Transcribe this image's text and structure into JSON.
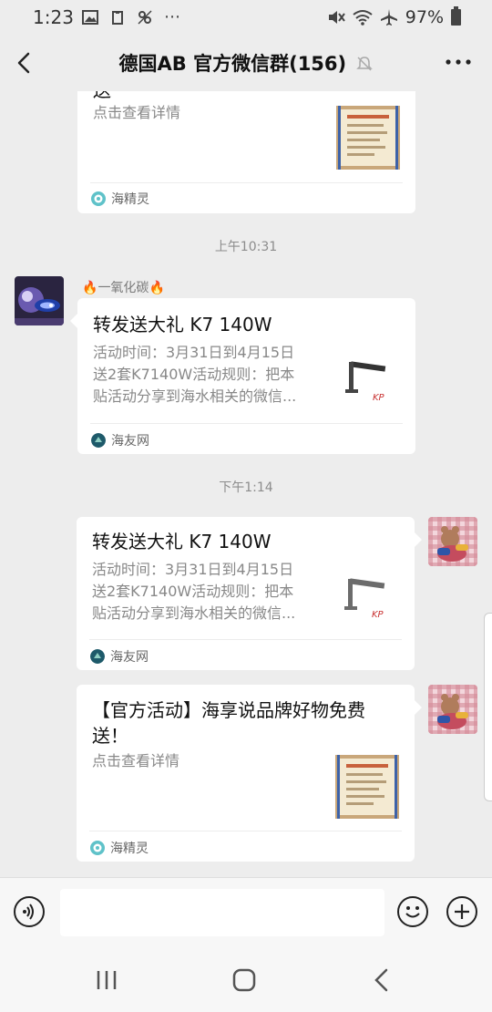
{
  "status_bar": {
    "time": "1:23",
    "battery": "97%",
    "left_icons": [
      "gallery-icon",
      "clipboard-icon",
      "mirror-icon",
      "more-dots-icon"
    ],
    "right_icons": [
      "mute-icon",
      "wifi-icon",
      "airplane-icon",
      "battery-icon"
    ]
  },
  "header": {
    "title": "德国AB  官方微信群(156)",
    "muted": true
  },
  "messages": {
    "card0": {
      "title_fragment": "送",
      "desc": "点击查看详情",
      "source": "海精灵"
    },
    "ts1": "上午10:31",
    "card1": {
      "sender": "一氧化碳",
      "title": "转发送大礼 K7 140W",
      "desc1": "活动时间：3月31日到4月15日",
      "desc2": "送2套K7140W活动规则：把本",
      "desc3": "贴活动分享到海水相关的微信...",
      "source": "海友网"
    },
    "ts2": "下午1:14",
    "card2": {
      "title": "转发送大礼 K7 140W",
      "desc1": "活动时间：3月31日到4月15日",
      "desc2": "送2套K7140W活动规则：把本",
      "desc3": "贴活动分享到海水相关的微信...",
      "source": "海友网"
    },
    "card3": {
      "title1": "【官方活动】海享说品牌好物免费",
      "title2": "送！",
      "desc": "点击查看详情",
      "source": "海精灵"
    }
  },
  "colors": {
    "background": "#ededed",
    "card": "#ffffff",
    "muted_text": "#888888"
  }
}
